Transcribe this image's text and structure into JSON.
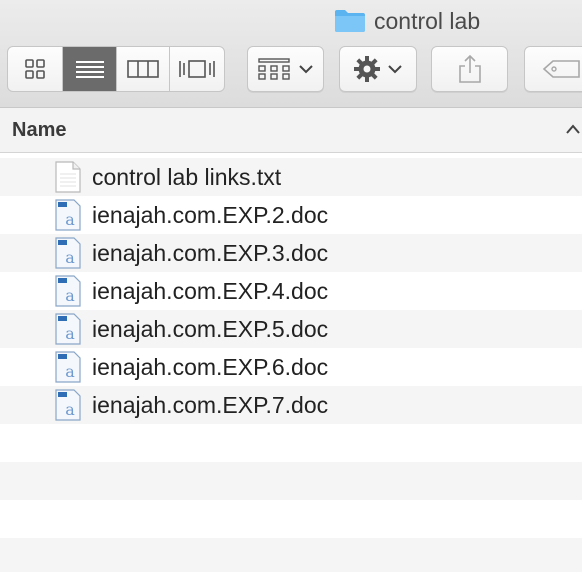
{
  "window": {
    "title": "control lab"
  },
  "toolbar": {
    "view_icons": "grid-icon",
    "view_list": "list-icon",
    "view_columns": "columns-icon",
    "view_coverflow": "coverflow-icon",
    "group_icon": "arrange-icon",
    "action_icon": "gear-icon",
    "share_icon": "share-icon",
    "tag_icon": "tag-icon"
  },
  "columns": {
    "name": "Name"
  },
  "files": [
    {
      "name": "control lab links.txt",
      "kind": "txt"
    },
    {
      "name": "ienajah.com.EXP.2.doc",
      "kind": "doc"
    },
    {
      "name": "ienajah.com.EXP.3.doc",
      "kind": "doc"
    },
    {
      "name": "ienajah.com.EXP.4.doc",
      "kind": "doc"
    },
    {
      "name": "ienajah.com.EXP.5.doc",
      "kind": "doc"
    },
    {
      "name": "ienajah.com.EXP.6.doc",
      "kind": "doc"
    },
    {
      "name": "ienajah.com.EXP.7.doc",
      "kind": "doc"
    }
  ],
  "colors": {
    "folder": "#5bb3f0",
    "active_segment": "#6b6b6b",
    "stripe": "#f5f5f5"
  }
}
